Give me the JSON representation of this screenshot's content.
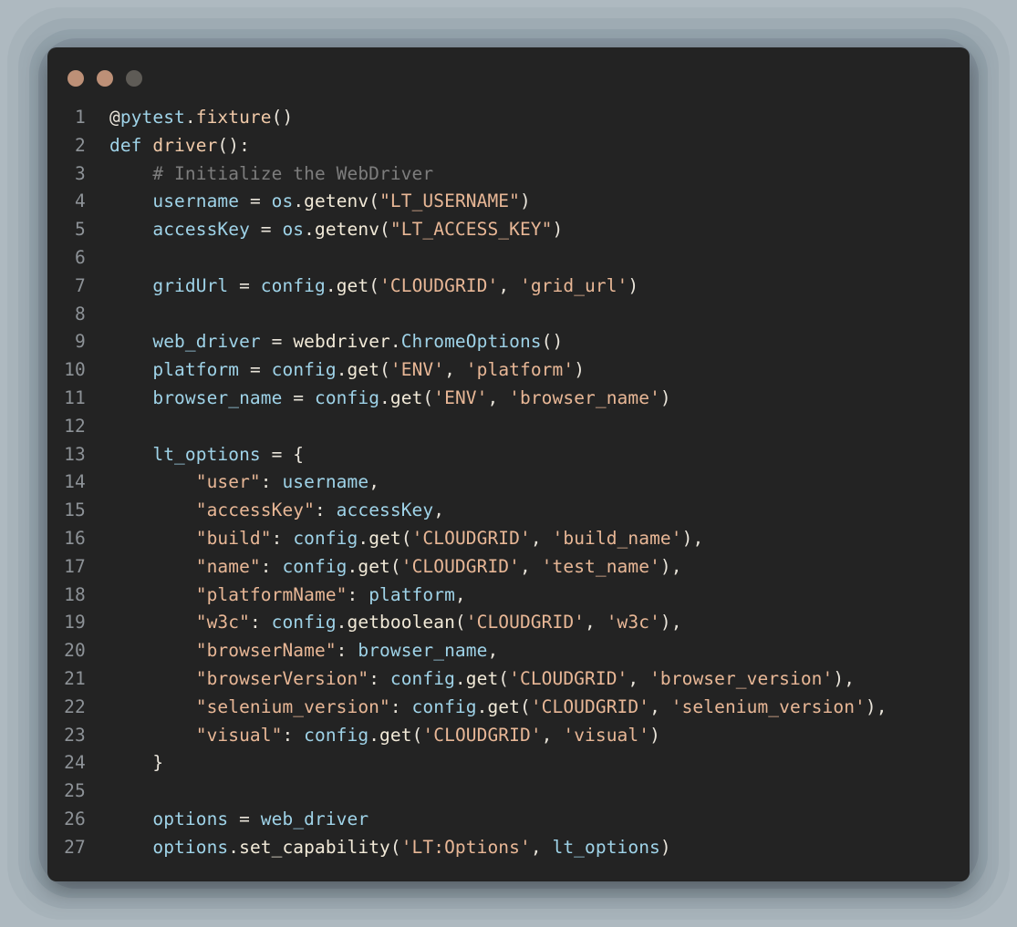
{
  "window": {
    "background_color": "#aeb9c0",
    "panel_color": "#232323",
    "traffic_lights": [
      {
        "name": "close-dot",
        "color": "#bd9077"
      },
      {
        "name": "minimize-dot",
        "color": "#bd9077"
      },
      {
        "name": "maximize-dot",
        "color": "#5e5b56"
      }
    ]
  },
  "editor": {
    "language": "python",
    "line_numbers": [
      "1",
      "2",
      "3",
      "4",
      "5",
      "6",
      "7",
      "8",
      "9",
      "10",
      "11",
      "12",
      "13",
      "14",
      "15",
      "16",
      "17",
      "18",
      "19",
      "20",
      "21",
      "22",
      "23",
      "24",
      "25",
      "26",
      "27"
    ],
    "lines": [
      {
        "n": "1",
        "text": "@pytest.fixture()"
      },
      {
        "n": "2",
        "text": "def driver():"
      },
      {
        "n": "3",
        "text": "    # Initialize the WebDriver"
      },
      {
        "n": "4",
        "text": "    username = os.getenv(\"LT_USERNAME\")"
      },
      {
        "n": "5",
        "text": "    accessKey = os.getenv(\"LT_ACCESS_KEY\")"
      },
      {
        "n": "6",
        "text": ""
      },
      {
        "n": "7",
        "text": "    gridUrl = config.get('CLOUDGRID', 'grid_url')"
      },
      {
        "n": "8",
        "text": ""
      },
      {
        "n": "9",
        "text": "    web_driver = webdriver.ChromeOptions()"
      },
      {
        "n": "10",
        "text": "    platform = config.get('ENV', 'platform')"
      },
      {
        "n": "11",
        "text": "    browser_name = config.get('ENV', 'browser_name')"
      },
      {
        "n": "12",
        "text": ""
      },
      {
        "n": "13",
        "text": "    lt_options = {"
      },
      {
        "n": "14",
        "text": "        \"user\": username,"
      },
      {
        "n": "15",
        "text": "        \"accessKey\": accessKey,"
      },
      {
        "n": "16",
        "text": "        \"build\": config.get('CLOUDGRID', 'build_name'),"
      },
      {
        "n": "17",
        "text": "        \"name\": config.get('CLOUDGRID', 'test_name'),"
      },
      {
        "n": "18",
        "text": "        \"platformName\": platform,"
      },
      {
        "n": "19",
        "text": "        \"w3c\": config.getboolean('CLOUDGRID', 'w3c'),"
      },
      {
        "n": "20",
        "text": "        \"browserName\": browser_name,"
      },
      {
        "n": "21",
        "text": "        \"browserVersion\": config.get('CLOUDGRID', 'browser_version'),"
      },
      {
        "n": "22",
        "text": "        \"selenium_version\": config.get('CLOUDGRID', 'selenium_version'),"
      },
      {
        "n": "23",
        "text": "        \"visual\": config.get('CLOUDGRID', 'visual')"
      },
      {
        "n": "24",
        "text": "    }"
      },
      {
        "n": "25",
        "text": ""
      },
      {
        "n": "26",
        "text": "    options = web_driver"
      },
      {
        "n": "27",
        "text": "    options.set_capability('LT:Options', lt_options)"
      }
    ],
    "tokens": [
      [
        {
          "t": "@",
          "c": "t-plain"
        },
        {
          "t": "pytest",
          "c": "t-kw"
        },
        {
          "t": ".",
          "c": "t-plain"
        },
        {
          "t": "fixture",
          "c": "t-attr"
        },
        {
          "t": "()",
          "c": "t-plain"
        }
      ],
      [
        {
          "t": "def ",
          "c": "t-kw"
        },
        {
          "t": "driver",
          "c": "t-attr"
        },
        {
          "t": "():",
          "c": "t-plain"
        }
      ],
      [
        {
          "t": "    # Initialize the WebDriver",
          "c": "t-cmt"
        }
      ],
      [
        {
          "t": "    ",
          "c": "t-plain"
        },
        {
          "t": "username",
          "c": "t-var"
        },
        {
          "t": " = ",
          "c": "t-plain"
        },
        {
          "t": "os",
          "c": "t-var"
        },
        {
          "t": ".",
          "c": "t-plain"
        },
        {
          "t": "getenv",
          "c": "t-fn"
        },
        {
          "t": "(",
          "c": "t-plain"
        },
        {
          "t": "\"LT_USERNAME\"",
          "c": "t-str"
        },
        {
          "t": ")",
          "c": "t-plain"
        }
      ],
      [
        {
          "t": "    ",
          "c": "t-plain"
        },
        {
          "t": "accessKey",
          "c": "t-var"
        },
        {
          "t": " = ",
          "c": "t-plain"
        },
        {
          "t": "os",
          "c": "t-var"
        },
        {
          "t": ".",
          "c": "t-plain"
        },
        {
          "t": "getenv",
          "c": "t-fn"
        },
        {
          "t": "(",
          "c": "t-plain"
        },
        {
          "t": "\"LT_ACCESS_KEY\"",
          "c": "t-str"
        },
        {
          "t": ")",
          "c": "t-plain"
        }
      ],
      [],
      [
        {
          "t": "    ",
          "c": "t-plain"
        },
        {
          "t": "gridUrl",
          "c": "t-var"
        },
        {
          "t": " = ",
          "c": "t-plain"
        },
        {
          "t": "config",
          "c": "t-var"
        },
        {
          "t": ".",
          "c": "t-plain"
        },
        {
          "t": "get",
          "c": "t-fn"
        },
        {
          "t": "(",
          "c": "t-plain"
        },
        {
          "t": "'CLOUDGRID'",
          "c": "t-str"
        },
        {
          "t": ", ",
          "c": "t-plain"
        },
        {
          "t": "'grid_url'",
          "c": "t-str"
        },
        {
          "t": ")",
          "c": "t-plain"
        }
      ],
      [],
      [
        {
          "t": "    ",
          "c": "t-plain"
        },
        {
          "t": "web_driver",
          "c": "t-var"
        },
        {
          "t": " = ",
          "c": "t-plain"
        },
        {
          "t": "webdriver",
          "c": "t-mod"
        },
        {
          "t": ".",
          "c": "t-plain"
        },
        {
          "t": "ChromeOptions",
          "c": "t-cls"
        },
        {
          "t": "()",
          "c": "t-plain"
        }
      ],
      [
        {
          "t": "    ",
          "c": "t-plain"
        },
        {
          "t": "platform",
          "c": "t-var"
        },
        {
          "t": " = ",
          "c": "t-plain"
        },
        {
          "t": "config",
          "c": "t-var"
        },
        {
          "t": ".",
          "c": "t-plain"
        },
        {
          "t": "get",
          "c": "t-fn"
        },
        {
          "t": "(",
          "c": "t-plain"
        },
        {
          "t": "'ENV'",
          "c": "t-str"
        },
        {
          "t": ", ",
          "c": "t-plain"
        },
        {
          "t": "'platform'",
          "c": "t-str"
        },
        {
          "t": ")",
          "c": "t-plain"
        }
      ],
      [
        {
          "t": "    ",
          "c": "t-plain"
        },
        {
          "t": "browser_name",
          "c": "t-var"
        },
        {
          "t": " = ",
          "c": "t-plain"
        },
        {
          "t": "config",
          "c": "t-var"
        },
        {
          "t": ".",
          "c": "t-plain"
        },
        {
          "t": "get",
          "c": "t-fn"
        },
        {
          "t": "(",
          "c": "t-plain"
        },
        {
          "t": "'ENV'",
          "c": "t-str"
        },
        {
          "t": ", ",
          "c": "t-plain"
        },
        {
          "t": "'browser_name'",
          "c": "t-str"
        },
        {
          "t": ")",
          "c": "t-plain"
        }
      ],
      [],
      [
        {
          "t": "    ",
          "c": "t-plain"
        },
        {
          "t": "lt_options",
          "c": "t-var"
        },
        {
          "t": " = {",
          "c": "t-plain"
        }
      ],
      [
        {
          "t": "        ",
          "c": "t-plain"
        },
        {
          "t": "\"user\"",
          "c": "t-str"
        },
        {
          "t": ": ",
          "c": "t-plain"
        },
        {
          "t": "username",
          "c": "t-var"
        },
        {
          "t": ",",
          "c": "t-plain"
        }
      ],
      [
        {
          "t": "        ",
          "c": "t-plain"
        },
        {
          "t": "\"accessKey\"",
          "c": "t-str"
        },
        {
          "t": ": ",
          "c": "t-plain"
        },
        {
          "t": "accessKey",
          "c": "t-var"
        },
        {
          "t": ",",
          "c": "t-plain"
        }
      ],
      [
        {
          "t": "        ",
          "c": "t-plain"
        },
        {
          "t": "\"build\"",
          "c": "t-str"
        },
        {
          "t": ": ",
          "c": "t-plain"
        },
        {
          "t": "config",
          "c": "t-var"
        },
        {
          "t": ".",
          "c": "t-plain"
        },
        {
          "t": "get",
          "c": "t-fn"
        },
        {
          "t": "(",
          "c": "t-plain"
        },
        {
          "t": "'CLOUDGRID'",
          "c": "t-str"
        },
        {
          "t": ", ",
          "c": "t-plain"
        },
        {
          "t": "'build_name'",
          "c": "t-str"
        },
        {
          "t": "),",
          "c": "t-plain"
        }
      ],
      [
        {
          "t": "        ",
          "c": "t-plain"
        },
        {
          "t": "\"name\"",
          "c": "t-str"
        },
        {
          "t": ": ",
          "c": "t-plain"
        },
        {
          "t": "config",
          "c": "t-var"
        },
        {
          "t": ".",
          "c": "t-plain"
        },
        {
          "t": "get",
          "c": "t-fn"
        },
        {
          "t": "(",
          "c": "t-plain"
        },
        {
          "t": "'CLOUDGRID'",
          "c": "t-str"
        },
        {
          "t": ", ",
          "c": "t-plain"
        },
        {
          "t": "'test_name'",
          "c": "t-str"
        },
        {
          "t": "),",
          "c": "t-plain"
        }
      ],
      [
        {
          "t": "        ",
          "c": "t-plain"
        },
        {
          "t": "\"platformName\"",
          "c": "t-str"
        },
        {
          "t": ": ",
          "c": "t-plain"
        },
        {
          "t": "platform",
          "c": "t-var"
        },
        {
          "t": ",",
          "c": "t-plain"
        }
      ],
      [
        {
          "t": "        ",
          "c": "t-plain"
        },
        {
          "t": "\"w3c\"",
          "c": "t-str"
        },
        {
          "t": ": ",
          "c": "t-plain"
        },
        {
          "t": "config",
          "c": "t-var"
        },
        {
          "t": ".",
          "c": "t-plain"
        },
        {
          "t": "getboolean",
          "c": "t-fn"
        },
        {
          "t": "(",
          "c": "t-plain"
        },
        {
          "t": "'CLOUDGRID'",
          "c": "t-str"
        },
        {
          "t": ", ",
          "c": "t-plain"
        },
        {
          "t": "'w3c'",
          "c": "t-str"
        },
        {
          "t": "),",
          "c": "t-plain"
        }
      ],
      [
        {
          "t": "        ",
          "c": "t-plain"
        },
        {
          "t": "\"browserName\"",
          "c": "t-str"
        },
        {
          "t": ": ",
          "c": "t-plain"
        },
        {
          "t": "browser_name",
          "c": "t-var"
        },
        {
          "t": ",",
          "c": "t-plain"
        }
      ],
      [
        {
          "t": "        ",
          "c": "t-plain"
        },
        {
          "t": "\"browserVersion\"",
          "c": "t-str"
        },
        {
          "t": ": ",
          "c": "t-plain"
        },
        {
          "t": "config",
          "c": "t-var"
        },
        {
          "t": ".",
          "c": "t-plain"
        },
        {
          "t": "get",
          "c": "t-fn"
        },
        {
          "t": "(",
          "c": "t-plain"
        },
        {
          "t": "'CLOUDGRID'",
          "c": "t-str"
        },
        {
          "t": ", ",
          "c": "t-plain"
        },
        {
          "t": "'browser_version'",
          "c": "t-str"
        },
        {
          "t": "),",
          "c": "t-plain"
        }
      ],
      [
        {
          "t": "        ",
          "c": "t-plain"
        },
        {
          "t": "\"selenium_version\"",
          "c": "t-str"
        },
        {
          "t": ": ",
          "c": "t-plain"
        },
        {
          "t": "config",
          "c": "t-var"
        },
        {
          "t": ".",
          "c": "t-plain"
        },
        {
          "t": "get",
          "c": "t-fn"
        },
        {
          "t": "(",
          "c": "t-plain"
        },
        {
          "t": "'CLOUDGRID'",
          "c": "t-str"
        },
        {
          "t": ", ",
          "c": "t-plain"
        },
        {
          "t": "'selenium_version'",
          "c": "t-str"
        },
        {
          "t": "),",
          "c": "t-plain"
        }
      ],
      [
        {
          "t": "        ",
          "c": "t-plain"
        },
        {
          "t": "\"visual\"",
          "c": "t-str"
        },
        {
          "t": ": ",
          "c": "t-plain"
        },
        {
          "t": "config",
          "c": "t-var"
        },
        {
          "t": ".",
          "c": "t-plain"
        },
        {
          "t": "get",
          "c": "t-fn"
        },
        {
          "t": "(",
          "c": "t-plain"
        },
        {
          "t": "'CLOUDGRID'",
          "c": "t-str"
        },
        {
          "t": ", ",
          "c": "t-plain"
        },
        {
          "t": "'visual'",
          "c": "t-str"
        },
        {
          "t": ")",
          "c": "t-plain"
        }
      ],
      [
        {
          "t": "    }",
          "c": "t-plain"
        }
      ],
      [],
      [
        {
          "t": "    ",
          "c": "t-plain"
        },
        {
          "t": "options",
          "c": "t-var"
        },
        {
          "t": " = ",
          "c": "t-plain"
        },
        {
          "t": "web_driver",
          "c": "t-var"
        }
      ],
      [
        {
          "t": "    ",
          "c": "t-plain"
        },
        {
          "t": "options",
          "c": "t-var"
        },
        {
          "t": ".",
          "c": "t-plain"
        },
        {
          "t": "set_capability",
          "c": "t-fn"
        },
        {
          "t": "(",
          "c": "t-plain"
        },
        {
          "t": "'LT:Options'",
          "c": "t-str"
        },
        {
          "t": ", ",
          "c": "t-plain"
        },
        {
          "t": "lt_options",
          "c": "t-var"
        },
        {
          "t": ")",
          "c": "t-plain"
        }
      ]
    ]
  }
}
